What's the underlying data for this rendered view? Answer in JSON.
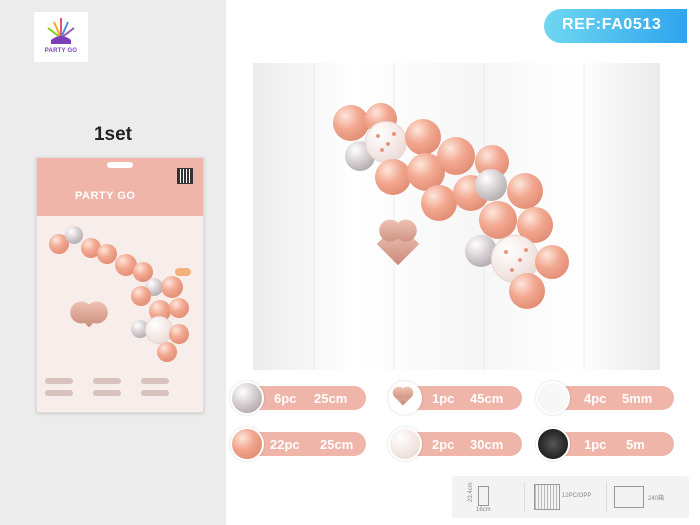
{
  "logo": {
    "text": "PARTY GO"
  },
  "set_label": "1set",
  "package": {
    "brand": "PARTY GO"
  },
  "ref": {
    "text": "REF:FA0513",
    "color_start": "#6fd8f0",
    "color_end": "#2ea4ee"
  },
  "accent_color": "#efb5a8",
  "specs": [
    {
      "icon": "chrome-balloon-icon",
      "qty": "6pc",
      "size": "25cm"
    },
    {
      "icon": "heart-foil-balloon-icon",
      "qty": "1pc",
      "size": "45cm"
    },
    {
      "icon": "glue-dots-icon",
      "qty": "4pc",
      "size": "5mm"
    },
    {
      "icon": "rose-gold-balloon-icon",
      "qty": "22pc",
      "size": "25cm"
    },
    {
      "icon": "confetti-balloon-icon",
      "qty": "2pc",
      "size": "30cm"
    },
    {
      "icon": "balloon-strip-icon",
      "qty": "1pc",
      "size": "5m"
    }
  ],
  "packaging": {
    "height_label": "23.4cm",
    "width_label": "16cm",
    "opp_label": "12PC/OPP",
    "carton_label": "240箱"
  }
}
